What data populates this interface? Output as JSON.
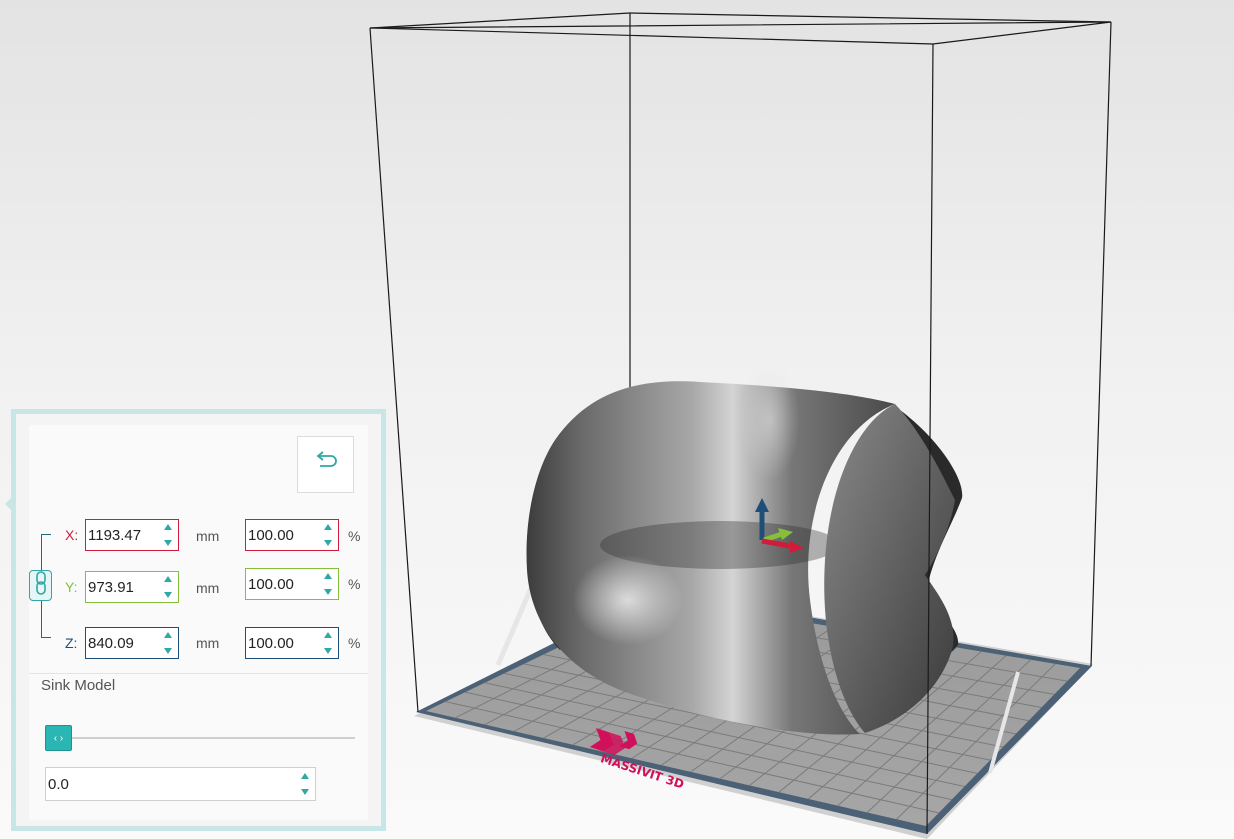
{
  "scale_panel": {
    "x": {
      "label": "X:",
      "value": "1193.47",
      "unit": "mm",
      "percent": "100.00",
      "percent_unit": "%",
      "color": "#d01c3a"
    },
    "y": {
      "label": "Y:",
      "value": "973.91",
      "unit": "mm",
      "percent": "100.00",
      "percent_unit": "%",
      "color": "#86c03a"
    },
    "z": {
      "label": "Z:",
      "value": "840.09",
      "unit": "mm",
      "percent": "100.00",
      "percent_unit": "%",
      "color": "#1e4f78"
    },
    "reset_icon": "undo-icon",
    "lock_icon": "chain-link-icon",
    "uniform_scaling_locked": true,
    "sink_model": {
      "label": "Sink Model",
      "slider_value": 0,
      "slider_icon": "left-right-arrows-icon",
      "value": "0.0"
    }
  },
  "viewport": {
    "plate_logo_text": "MASSIVIT 3D",
    "plate_logo_color": "#d0105a",
    "gizmo_colors": {
      "x": "#d01c3a",
      "y": "#86c03a",
      "z": "#1e4f78"
    }
  }
}
